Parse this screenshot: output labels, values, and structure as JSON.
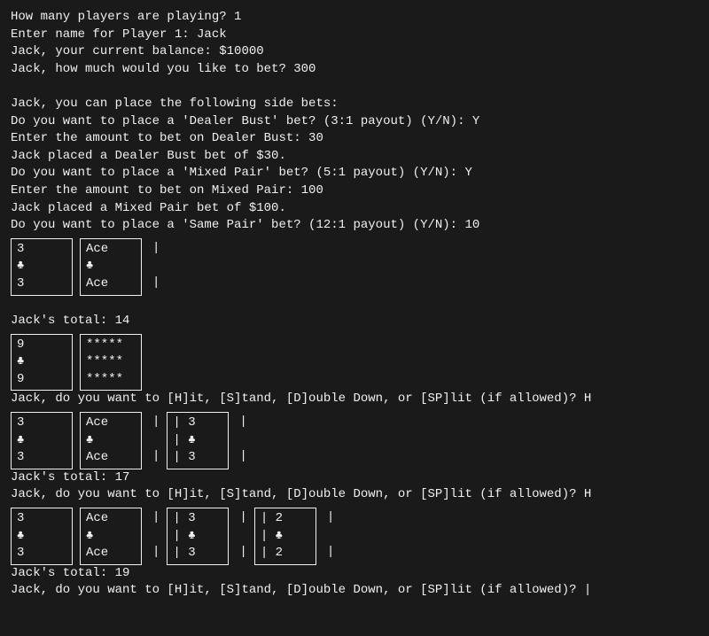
{
  "terminal": {
    "lines": [
      "How many players are playing? 1",
      "Enter name for Player 1: Jack",
      "Jack, your current balance: $10000",
      "Jack, how much would you like to bet? 300",
      "",
      "Jack, you can place the following side bets:",
      "Do you want to place a 'Dealer Bust' bet? (3:1 payout) (Y/N): Y",
      "Enter the amount to bet on Dealer Bust: 30",
      "Jack placed a Dealer Bust bet of $30.",
      "Do you want to place a 'Mixed Pair' bet? (5:1 payout) (Y/N): Y",
      "Enter the amount to bet on Mixed Pair: 100",
      "Jack placed a Mixed Pair bet of $100.",
      "Do you want to place a 'Same Pair' bet? (12:1 payout) (Y/N): 10"
    ],
    "section1": {
      "cards": [
        {
          "lines": [
            "3",
            "♣",
            "3"
          ],
          "type": "normal"
        },
        {
          "lines": [
            "Ace",
            "♣",
            "Ace"
          ],
          "type": "normal"
        },
        {
          "lines": [
            "|",
            "",
            "|"
          ],
          "type": "pipe"
        }
      ],
      "total": "Jack's total: 14"
    },
    "section2": {
      "cards": [
        {
          "lines": [
            "9",
            "♣",
            "9"
          ],
          "type": "normal"
        },
        {
          "lines": [
            "*****",
            "*****",
            "*****"
          ],
          "type": "hidden"
        }
      ],
      "prompt": "Jack, do you want to [H]it, [S]tand, [D]ouble Down, or [SP]lit (if allowed)? H"
    },
    "section3": {
      "cards_row1": "3   | Ace   |   | 3   |",
      "cards_row2": "♣   | ♣     |   | ♣   |",
      "cards_row3": "3   | Ace   |   | 3   |",
      "total": "Jack's total: 17",
      "prompt": "Jack, do you want to [H]it, [S]tand, [D]ouble Down, or [SP]lit (if allowed)? H"
    },
    "section4": {
      "total": "Jack's total: 19",
      "prompt": "Jack, do you want to [H]it, [S]tand, [D]ouble Down, or [SP]lit (if allowed)? |"
    }
  }
}
